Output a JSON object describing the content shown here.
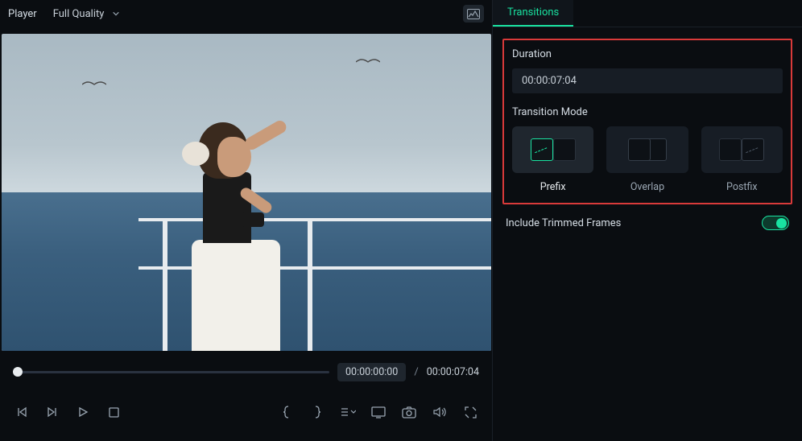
{
  "player": {
    "label": "Player",
    "quality": "Full Quality",
    "current_time": "00:00:00:00",
    "separator": "/",
    "end_time": "00:00:07:04"
  },
  "tabs": {
    "transitions": "Transitions"
  },
  "duration": {
    "label": "Duration",
    "value": "00:00:07:04"
  },
  "transition_mode": {
    "label": "Transition Mode",
    "options": [
      "Prefix",
      "Overlap",
      "Postfix"
    ],
    "selected": "Prefix"
  },
  "include_trimmed": {
    "label": "Include Trimmed Frames",
    "enabled": true
  },
  "icons": {
    "overlay": "image-waveform-icon",
    "step_back": "step-back-icon",
    "play_next": "play-next-icon",
    "play": "play-icon",
    "stop": "stop-icon",
    "brace_open": "brace-open-icon",
    "brace_close": "brace-close-icon",
    "markers": "markers-dropdown-icon",
    "screen": "screen-icon",
    "camera": "camera-icon",
    "volume": "volume-icon",
    "fullscreen": "fullscreen-icon",
    "chevron_down": "chevron-down-icon"
  }
}
